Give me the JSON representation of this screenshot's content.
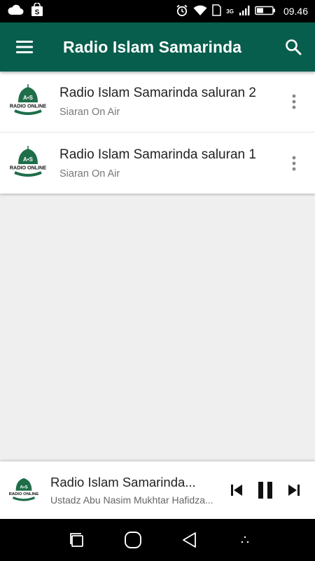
{
  "status_bar": {
    "time": "09.46",
    "network": "3G",
    "icons": [
      "cloud-icon",
      "shop-bag-icon",
      "alarm-icon",
      "wifi-icon",
      "sim-icon",
      "signal-icon",
      "battery-icon"
    ]
  },
  "app_bar": {
    "title": "Radio Islam Samarinda",
    "color": "#075e4c",
    "menu_icon": "hamburger-menu-icon",
    "search_icon": "search-icon"
  },
  "stations": [
    {
      "title": "Radio Islam Samarinda saluran 2",
      "subtitle": "Siaran On Air",
      "logo_text": "RADIO ONLINE"
    },
    {
      "title": "Radio Islam Samarinda saluran 1",
      "subtitle": "Siaran On Air",
      "logo_text": "RADIO ONLINE"
    }
  ],
  "player": {
    "title": "Radio Islam Samarinda...",
    "subtitle": "Ustadz Abu Nasim Mukhtar Hafidza...",
    "controls": [
      "skip-previous-icon",
      "pause-icon",
      "skip-next-icon"
    ]
  },
  "nav_bar": {
    "buttons": [
      "recent-apps-icon",
      "home-icon",
      "back-icon",
      "menu-dots-icon"
    ]
  }
}
